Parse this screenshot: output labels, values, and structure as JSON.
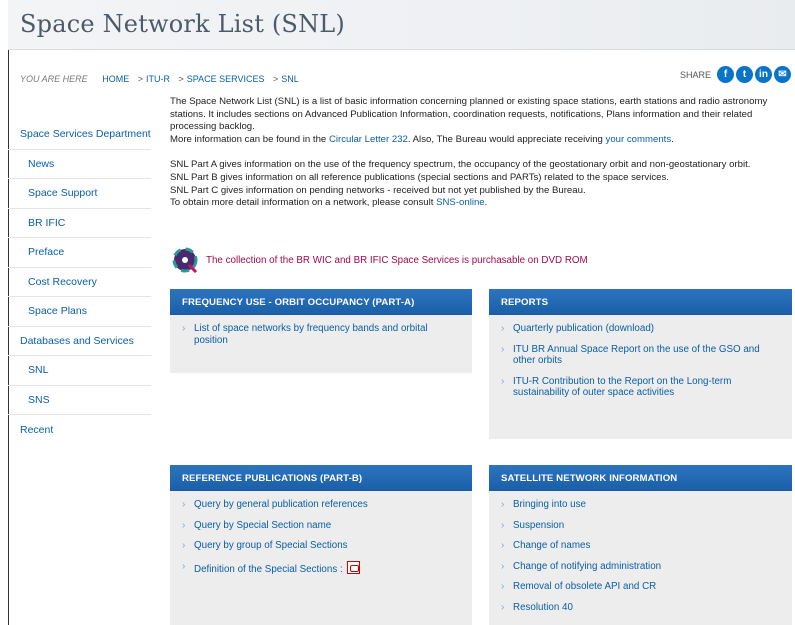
{
  "page": {
    "title": "Space Network List (SNL)"
  },
  "breadcrumb": {
    "here": "YOU ARE HERE",
    "items": [
      "HOME",
      "ITU-R",
      "SPACE SERVICES",
      "SNL"
    ]
  },
  "share": {
    "label": "SHARE",
    "icons": [
      "facebook-icon",
      "twitter-icon",
      "linkedin-icon",
      "email-icon"
    ]
  },
  "sidebar": {
    "items": [
      {
        "label": "Space Services Department",
        "level": "top"
      },
      {
        "label": "News",
        "level": "sub"
      },
      {
        "label": "Space Support",
        "level": "sub"
      },
      {
        "label": "BR IFIC",
        "level": "sub"
      },
      {
        "label": "Preface",
        "level": "sub"
      },
      {
        "label": "Cost Recovery",
        "level": "sub"
      },
      {
        "label": "Space Plans",
        "level": "sub"
      },
      {
        "label": "Databases and Services",
        "level": "top"
      },
      {
        "label": "SNL",
        "level": "sub"
      },
      {
        "label": "SNS",
        "level": "sub"
      },
      {
        "label": "Recent",
        "level": "top"
      }
    ]
  },
  "intro": {
    "p1": "The Space Network List (SNL) is a list of basic information concerning planned or existing space stations, earth stations and radio astronomy stations. It includes sections on Advanced Publication Information, coordination requests, notifications, Plans information and their related processing backlog.",
    "p2_pre": "More information can be found in the ",
    "p2_link1": "Circular Letter 232",
    "p2_mid": ". Also, The Bureau would appreciate receiving ",
    "p2_link2": "your comments",
    "p2_post": ".",
    "partA": "SNL Part A gives information on the use of the frequency spectrum, the occupancy of the geostationary orbit and non-geostationary orbit.",
    "partB": "SNL Part B gives information on all reference publications (special sections and PARTs) related to the space services.",
    "partC": "SNL Part C gives information on pending networks - received but not yet published by the Bureau.",
    "detail_pre": "To obtain more detail information on a network, please consult ",
    "detail_link": "SNS-online",
    "detail_post": "."
  },
  "dvd": {
    "text": "The collection of the BR WIC and BR IFIC Space Services is purchasable on DVD ROM"
  },
  "boxes": {
    "partA": {
      "title": "FREQUENCY USE - ORBIT OCCUPANCY (PART-A)",
      "items": [
        "List of space networks by frequency bands and orbital position"
      ]
    },
    "reports": {
      "title": "REPORTS",
      "items": [
        "Quarterly publication (download)",
        "ITU BR Annual Space Report on the use of the GSO and other orbits",
        "ITU-R Contribution to the Report on the Long-term sustainability of outer space activities"
      ]
    },
    "partB": {
      "title": "REFERENCE PUBLICATIONS (PART-B)",
      "items": [
        "Query by general publication references",
        "Query by Special Section name",
        "Query by group of Special Sections",
        "Definition of the Special Sections :"
      ]
    },
    "satnet": {
      "title": "SATELLITE NETWORK INFORMATION",
      "items": [
        "Bringing into use",
        "Suspension",
        "Change of names",
        "Change of notifying administration",
        "Removal of obsolete API and CR",
        "Resolution 40"
      ]
    }
  }
}
